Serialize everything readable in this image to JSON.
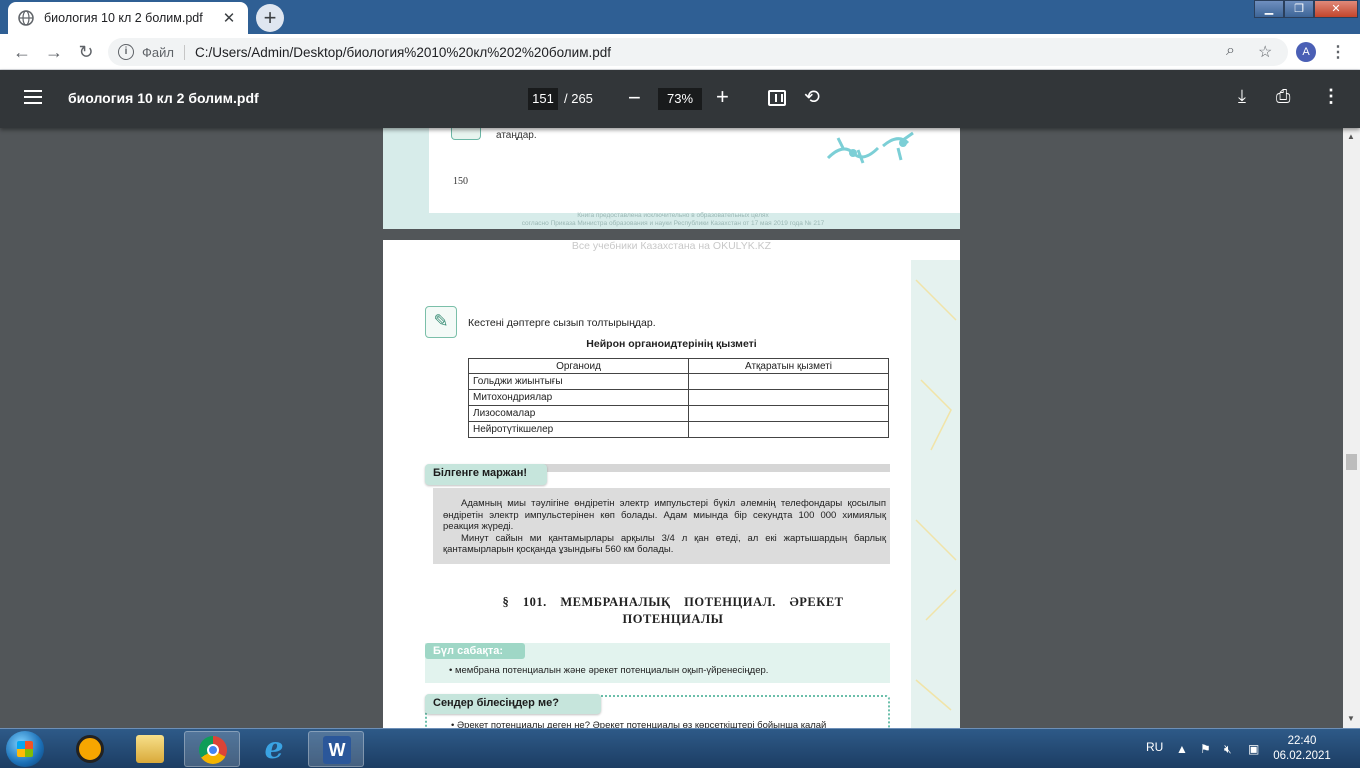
{
  "browser": {
    "tab_title": "биология 10 кл 2 болим.pdf",
    "tab_close": "✕",
    "new_tab": "+",
    "scheme_label": "Файл",
    "url": "C:/Users/Admin/Desktop/биология%2010%20кл%202%20болим.pdf",
    "profile_initial": "A"
  },
  "pdf_toolbar": {
    "doc_name": "биология 10 кл 2 болим.pdf",
    "current_page": "151",
    "total_pages": "/ 265",
    "zoom": "73%"
  },
  "page150": {
    "fragment_text": "атаңдар.",
    "page_number": "150",
    "footer_note_1": "Книга предоставлена исключительно в образовательных целях",
    "footer_note_2": "согласно Приказа Министра образования и науки Республики Казахстан от 17 мая 2019 года № 217"
  },
  "page151": {
    "watermark": "Все учебники Казахстана на OKULYK.KZ",
    "task_text": "Кестені дәптерге сызып толтырыңдар.",
    "table_title": "Нейрон органоидтерінің қызметі",
    "table_headers": [
      "Органоид",
      "Атқаратын қызметі"
    ],
    "table_rows": [
      "Гольджи жиынтығы",
      "Митохондриялар",
      "Лизосомалар",
      "Нейротүтікшелер"
    ],
    "fact_header": "Білгенге маржан!",
    "fact_p1": "Адамның миы тәулігіне өндіретін электр импульстері бүкіл әлемнің телефондары қосылып өндіретін электр импульстерінен көп болады. Адам миында бір секундта 100 000 химиялық реакция жүреді.",
    "fact_p2": "Минут сайын ми қантамырлары арқылы 3/4 л қан өтеді, ал екі жартышардың барлық қантамырларын қосқанда ұзындығы 560 км болады.",
    "section_title_line1": "§ 101.  МЕМБРАНАЛЫҚ  ПОТЕНЦИАЛ.  ӘРЕКЕТ",
    "section_title_line2": "ПОТЕНЦИАЛЫ",
    "lesson_header": "Бүл сабақта:",
    "lesson_item": "• мембрана потенциалын және әрекет потенциалын оқып-үйренесіңдер.",
    "know_header": "Сендер білесіңдер ме?",
    "know_item": "• Әрекет потенциалы деген не? Әрекет потенциалы өз көрсеткіштері бойынша қалай"
  },
  "taskbar": {
    "language": "RU",
    "time": "22:40",
    "date": "06.02.2021"
  },
  "colors": {
    "tabstrip": "#2f5f94",
    "pdf_toolbar": "#323639",
    "viewer_bg": "#525659",
    "accent_teal": "#9fd7c6"
  }
}
